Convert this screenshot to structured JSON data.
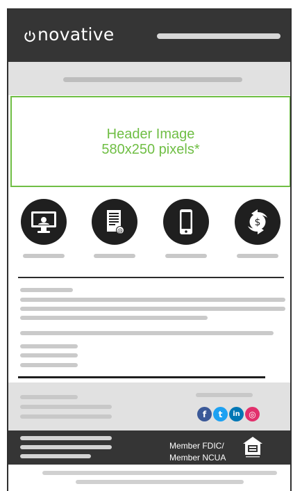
{
  "brand": {
    "logo_text": "novative",
    "logo_icon": "power-icon"
  },
  "hero": {
    "line1": "Header Image",
    "line2": "580x250 pixels*"
  },
  "icons": [
    {
      "name": "monitor-icon"
    },
    {
      "name": "document-icon"
    },
    {
      "name": "smartphone-icon"
    },
    {
      "name": "money-transfer-icon"
    }
  ],
  "footer": {
    "member_line1": "Member FDIC/",
    "member_line2": "Member NCUA",
    "social": [
      {
        "name": "facebook-icon",
        "glyph": "f",
        "color": "#3b5998"
      },
      {
        "name": "twitter-icon",
        "glyph": "t",
        "color": "#1da1f2"
      },
      {
        "name": "linkedin-icon",
        "glyph": "in",
        "color": "#0077b5"
      },
      {
        "name": "instagram-icon",
        "glyph": "◎",
        "color": "#e1306c"
      }
    ]
  },
  "colors": {
    "accent_green": "#6fbe44",
    "header_dark": "#353535",
    "light_gray": "#e1e1e1"
  }
}
